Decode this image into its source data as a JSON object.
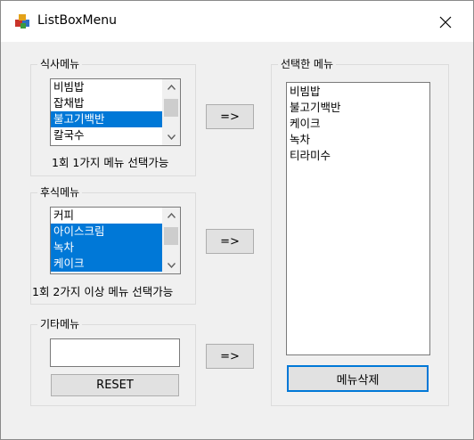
{
  "window": {
    "title": "ListBoxMenu",
    "icon": "app-cube-icon"
  },
  "meal_group": {
    "title": "식사메뉴",
    "items": [
      {
        "label": "비빔밥",
        "selected": false
      },
      {
        "label": "잡채밥",
        "selected": false
      },
      {
        "label": "불고기백반",
        "selected": true
      },
      {
        "label": "칼국수",
        "selected": false
      }
    ],
    "caption": "1회 1가지 메뉴 선택가능",
    "add_button": "=>"
  },
  "dessert_group": {
    "title": "후식메뉴",
    "items": [
      {
        "label": "커피",
        "selected": false
      },
      {
        "label": "아이스크림",
        "selected": true
      },
      {
        "label": "녹차",
        "selected": true
      },
      {
        "label": "케이크",
        "selected": true
      }
    ],
    "caption": "1회 2가지 이상 메뉴 선택가능",
    "add_button": "=>"
  },
  "other_group": {
    "title": "기타메뉴",
    "input_value": "",
    "add_button": "=>",
    "reset_button": "RESET"
  },
  "selected_group": {
    "title": "선택한 메뉴",
    "items": [
      "비빔밥",
      "불고기백반",
      "케이크",
      "녹차",
      "티라미수"
    ],
    "delete_button": "메뉴삭제"
  },
  "colors": {
    "selection": "#0078d7",
    "window_bg": "#f0f0f0",
    "button_bg": "#e1e1e1"
  }
}
